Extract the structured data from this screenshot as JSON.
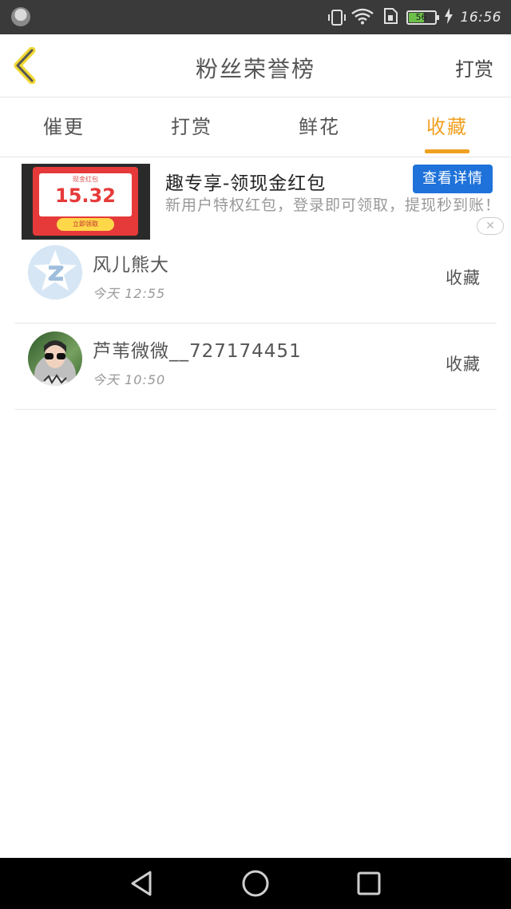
{
  "status_bar": {
    "battery_percent": "56",
    "time": "16:56"
  },
  "header": {
    "title": "粉丝荣誉榜",
    "right_action": "打赏"
  },
  "tabs": [
    {
      "label": "催更",
      "active": false
    },
    {
      "label": "打赏",
      "active": false
    },
    {
      "label": "鲜花",
      "active": false
    },
    {
      "label": "收藏",
      "active": true
    }
  ],
  "ad": {
    "image_small_text": "现金红包",
    "image_amount": "15.32",
    "image_button": "立即领取",
    "title": "趣专享-领现金红包",
    "description": "新用户特权红包，登录即可领取，提现秒到账！",
    "button": "查看详情",
    "close_icon": "close-icon"
  },
  "list": [
    {
      "name": "风儿熊大",
      "time": "今天  12:55",
      "action": "收藏",
      "avatar": "qq-default-avatar"
    },
    {
      "name": "芦苇微微__727174451",
      "time": "今天  10:50",
      "action": "收藏",
      "avatar": "user-photo-avatar"
    }
  ],
  "colors": {
    "accent": "#f0a020",
    "ad_button": "#1f72d9",
    "status_bar": "#3a3a3a"
  }
}
